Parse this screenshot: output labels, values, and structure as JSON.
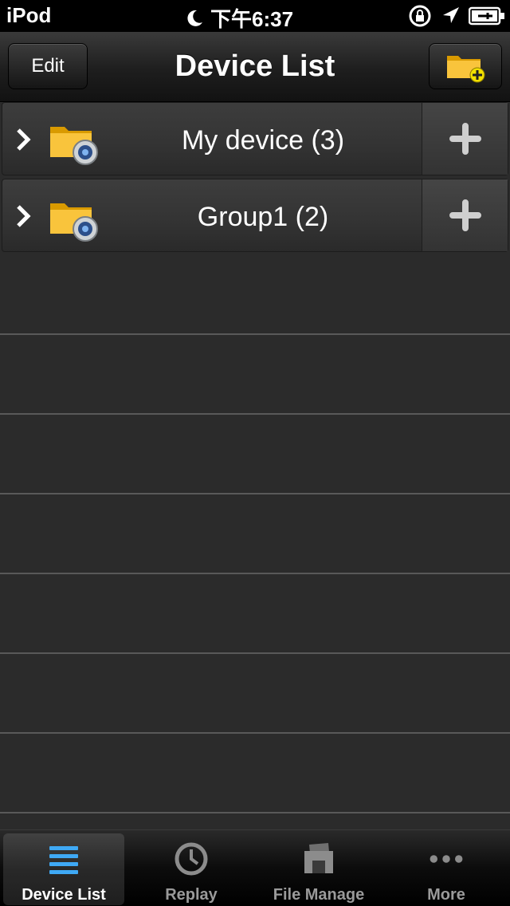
{
  "status_bar": {
    "device": "iPod",
    "time": "下午6:37"
  },
  "nav": {
    "edit_label": "Edit",
    "title": "Device List"
  },
  "devices": [
    {
      "label": "My device (3)"
    },
    {
      "label": "Group1 (2)"
    }
  ],
  "tabs": [
    {
      "label": "Device List",
      "icon": "list-icon",
      "active": true
    },
    {
      "label": "Replay",
      "icon": "clock-icon",
      "active": false
    },
    {
      "label": "File Manage",
      "icon": "files-icon",
      "active": false
    },
    {
      "label": "More",
      "icon": "more-dots-icon",
      "active": false
    }
  ],
  "colors": {
    "accent_blue": "#3fa9f5",
    "folder_yellow": "#f5b400"
  }
}
